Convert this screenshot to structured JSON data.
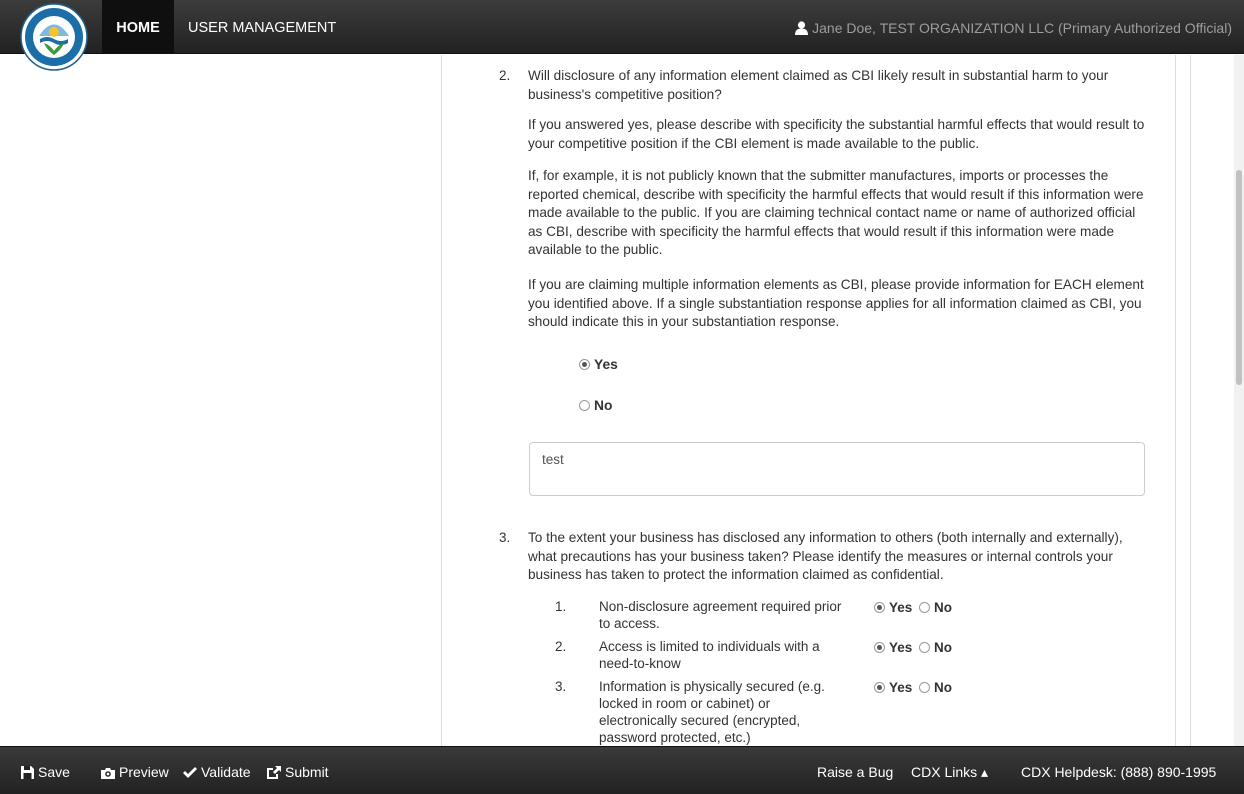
{
  "nav": {
    "home": "HOME",
    "user_management": "USER MANAGEMENT",
    "user": "Jane Doe, TEST ORGANIZATION LLC (Primary Authorized Official)"
  },
  "q2": {
    "number": "2.",
    "title": "Will disclosure of any information element claimed as CBI likely result in substantial harm to your business's competitive position?",
    "p1": "If you answered yes, please describe with specificity the substantial harmful effects that would result to your competitive position if the CBI element is made available to the public.",
    "p2": "If, for example, it is not publicly known that the submitter manufactures, imports or processes the reported chemical, describe with specificity the harmful effects that would result if this information were made available to the public. If you are claiming technical contact name or name of authorized official as CBI, describe with specificity the harmful effects that would result if this information were made available to the public.",
    "p3": "If you are claiming multiple information elements as CBI, please provide information for EACH element you identified above. If a single substantiation response applies for all information claimed as CBI, you should indicate this in your substantiation response.",
    "yes_label": "Yes",
    "no_label": "No",
    "answer": "test"
  },
  "q3": {
    "number": "3.",
    "title": "To the extent your business has disclosed any information to others (both internally and externally), what precautions has your business taken? Please identify the measures or internal controls your business has taken to protect the information claimed as confidential.",
    "items": [
      {
        "num": "1.",
        "text": "Non-disclosure agreement required prior to access.",
        "yes": "Yes",
        "no": "No"
      },
      {
        "num": "2.",
        "text": "Access is limited to individuals with a need-to-know",
        "yes": "Yes",
        "no": "No"
      },
      {
        "num": "3.",
        "text": "Information is physically secured (e.g. locked in room or cabinet) or electronically secured (encrypted, password protected, etc.)",
        "yes": "Yes",
        "no": "No"
      }
    ]
  },
  "footer": {
    "save": "Save",
    "preview": "Preview",
    "validate": "Validate",
    "submit": "Submit",
    "raise_bug": "Raise a Bug",
    "cdx_links": "CDX Links ▴",
    "helpdesk": "CDX Helpdesk: (888) 890-1995"
  }
}
